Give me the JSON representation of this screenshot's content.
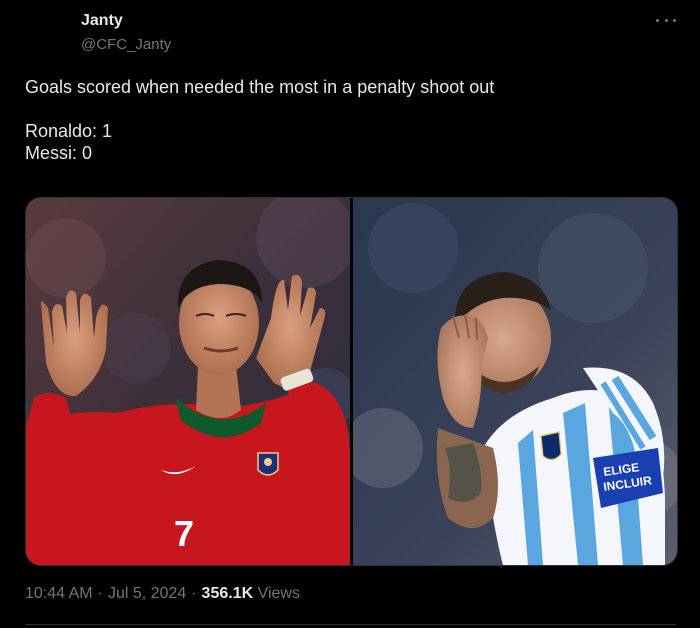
{
  "author": {
    "name": "Janty",
    "handle": "@CFC_Janty"
  },
  "tweet": {
    "lines": [
      "Goals scored when needed the most in a penalty shoot out",
      "Ronaldo: 1",
      "Messi: 0"
    ]
  },
  "media": {
    "left_photo": {
      "jersey_number": "7",
      "colors": {
        "shirt": "#c8161e",
        "collar": "#0d5a2c"
      }
    },
    "right_photo": {
      "armband_line1": "ELIGE",
      "armband_line2": "INCLUIR",
      "colors": {
        "stripe": "#5aa7e0",
        "armband": "#1a3fb0"
      }
    }
  },
  "meta": {
    "time": "10:44 AM",
    "date": "Jul 5, 2024",
    "views_count": "356.1K",
    "views_label": "Views",
    "separator": "·"
  },
  "icons": [
    "more-options-icon"
  ]
}
